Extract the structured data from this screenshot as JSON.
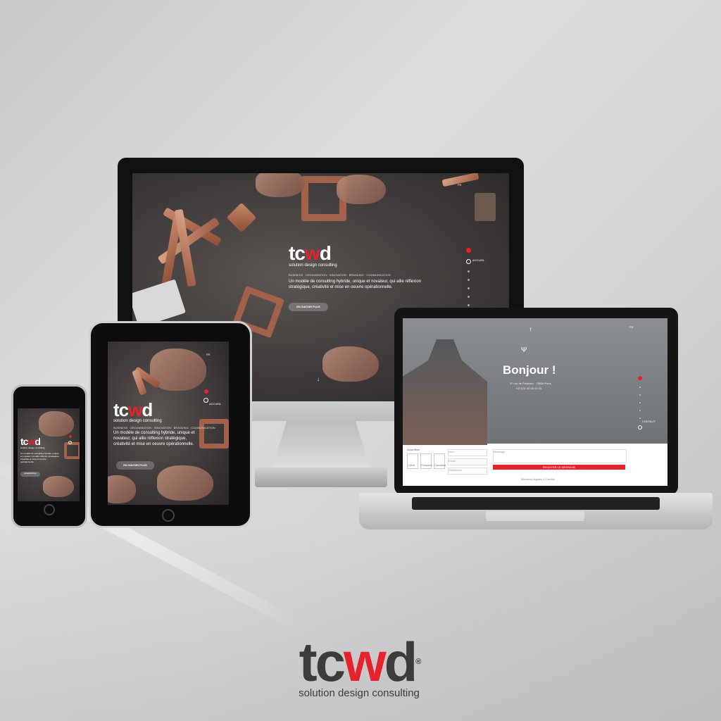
{
  "brand": {
    "word_a": "tc",
    "word_w": "w",
    "word_b": "d",
    "registered": "®",
    "tagline": "solution design consulting"
  },
  "hero": {
    "nav": "BUSINESS · ORGANISATION · INNOVATION · BRANDING · COMMUNICATION",
    "body": "Un modèle de consulting hybride, unique et novateur, qui allie réflexion stratégique, créativité et mise en oeuvre opérationnelle.",
    "cta": "EN SAVOIR PLUS",
    "lang": "FR",
    "active_section": "ACCUEIL",
    "scroll_arrow": "↓"
  },
  "contact_page": {
    "greeting": "Bonjour !",
    "address_line": "37 rue de Ponthieu · 75008 Paris",
    "phone_line": "+33 (0)1 40 06 00 00",
    "active_section": "CONTACT",
    "form_title": "Vous êtes",
    "options": [
      "Client",
      "Prospect",
      "Candidat"
    ],
    "fields": [
      "Nom",
      "Email",
      "Téléphone"
    ],
    "message_placeholder": "Message",
    "submit": "ENVOYER LE MESSAGE",
    "footer": "Mentions légales & Crédits"
  },
  "colors": {
    "accent": "#e8222b",
    "dark": "#3c3c3c"
  }
}
